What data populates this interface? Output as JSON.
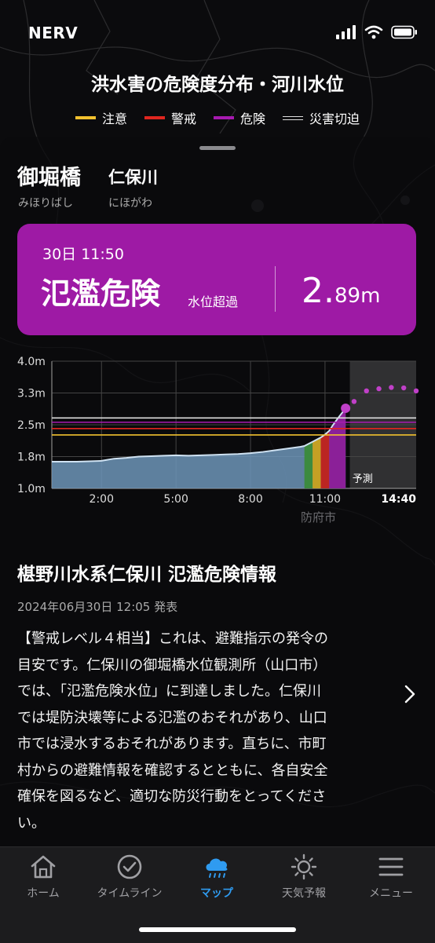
{
  "status_bar": {
    "carrier": "NERV"
  },
  "header": {
    "title": "洪水害の危険度分布・河川水位",
    "legend": [
      {
        "label": "注意",
        "color": "#f2c12e"
      },
      {
        "label": "警戒",
        "color": "#e0261f"
      },
      {
        "label": "危険",
        "color": "#a71ab0"
      },
      {
        "label": "災害切迫",
        "color": "#dddddd"
      }
    ]
  },
  "station": {
    "name": "御堀橋",
    "name_kana": "みほりばし",
    "river": "仁保川",
    "river_kana": "にほがわ"
  },
  "alert": {
    "time": "30日 11:50",
    "level": "氾濫危険",
    "sub": "水位超過",
    "value": "2.",
    "value_small": "89m",
    "color": "#9e1aa5"
  },
  "chart_data": {
    "type": "line",
    "ylim": [
      1.0,
      4.0
    ],
    "yticks": [
      "4.0m",
      "3.3m",
      "2.5m",
      "1.8m",
      "1.0m"
    ],
    "xticks": [
      "2:00",
      "5:00",
      "8:00",
      "11:00",
      "14:40"
    ],
    "forecast_label": "予測",
    "x_hours": [
      0.0,
      0.5,
      1.0,
      1.5,
      2.0,
      2.5,
      3.0,
      3.5,
      4.0,
      4.5,
      5.0,
      5.5,
      6.0,
      6.5,
      7.0,
      7.5,
      8.0,
      8.5,
      9.0,
      9.5,
      10.0,
      10.17,
      10.5,
      10.83,
      11.0,
      11.17,
      11.33,
      11.5,
      11.83
    ],
    "observed": [
      1.63,
      1.63,
      1.63,
      1.64,
      1.65,
      1.7,
      1.72,
      1.75,
      1.76,
      1.77,
      1.78,
      1.77,
      1.78,
      1.79,
      1.8,
      1.81,
      1.83,
      1.86,
      1.9,
      1.94,
      1.98,
      2.0,
      2.1,
      2.2,
      2.27,
      2.36,
      2.5,
      2.64,
      2.89
    ],
    "forecast_x": [
      12.17,
      12.67,
      13.17,
      13.67,
      14.17,
      14.67
    ],
    "forecast": [
      3.05,
      3.3,
      3.35,
      3.38,
      3.37,
      3.3
    ],
    "thresholds": [
      {
        "name": "注意",
        "value": 2.26,
        "color": "#f2c12e"
      },
      {
        "name": "警戒",
        "value": 2.41,
        "color": "#e0261f"
      },
      {
        "name": "危険",
        "value": 2.56,
        "color": "#a71ab0"
      },
      {
        "name": "災害切迫",
        "value": 2.66,
        "color": "#dddddd"
      }
    ]
  },
  "map_label": "防府市",
  "bulletin": {
    "title": "椹野川水系仁保川 氾濫危険情報",
    "date": "2024年06月30日 12:05 発表",
    "lines": [
      "【警戒レベル４相当】これは、避難指示の発令の",
      "目安です。仁保川の御堀橋水位観測所（山口市）",
      "では、「氾濫危険水位」に到達しました。仁保川",
      "では堤防決壊等による氾濫のおそれがあり、山口",
      "市では浸水するおそれがあります。直ちに、市町",
      "村からの避難情報を確認するとともに、各自安全",
      "確保を図るなど、適切な防災行動をとってくださ",
      "い。"
    ]
  },
  "tabs": [
    {
      "label": "ホーム",
      "icon": "home-icon"
    },
    {
      "label": "タイムライン",
      "icon": "check-circle-icon"
    },
    {
      "label": "マップ",
      "icon": "rain-cloud-icon",
      "active": true
    },
    {
      "label": "天気予報",
      "icon": "sun-icon"
    },
    {
      "label": "メニュー",
      "icon": "menu-icon"
    }
  ]
}
